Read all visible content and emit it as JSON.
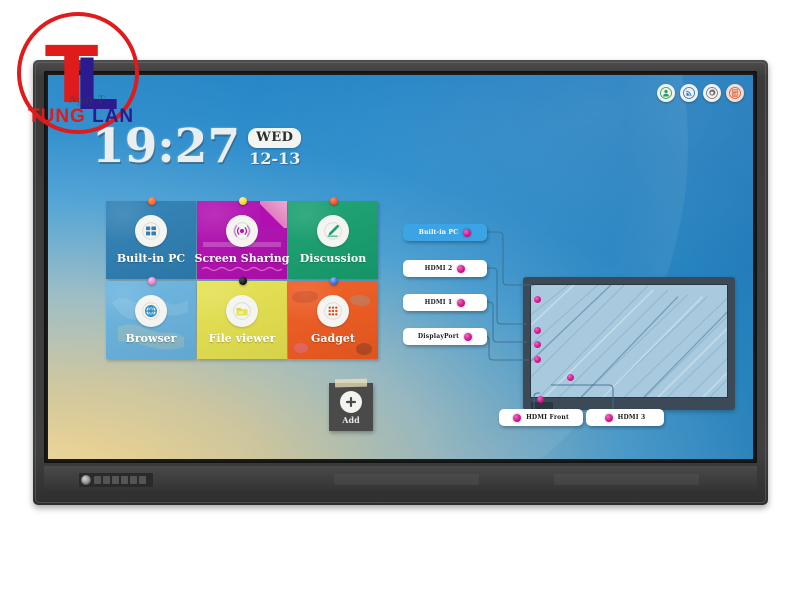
{
  "watermark": {
    "letter_t": "T",
    "letter_l": "L",
    "word_1": "TUNG",
    "word_2": "LAN",
    "subtitle": "Ngày T",
    "ring_color": "#e01b1b",
    "t_color": "#e01b1b",
    "l_color": "#2b1b8f"
  },
  "screen": {
    "clock": {
      "time": "19:27",
      "weekday": "WED",
      "date": "12-13"
    },
    "status_icons": [
      {
        "name": "user-icon",
        "glyph": "user",
        "bg": "#eef3ee",
        "fg": "#2e9a5e"
      },
      {
        "name": "wifi-icon",
        "glyph": "wifi",
        "bg": "#eef1f6",
        "fg": "#2f6fb0"
      },
      {
        "name": "settings-icon",
        "glyph": "gear",
        "bg": "#f1f1f1",
        "fg": "#6c6c6c"
      },
      {
        "name": "menu-icon",
        "glyph": "glyph-cn",
        "bg": "#f3ddd2",
        "fg": "#d8532a"
      }
    ],
    "tiles": [
      {
        "label": "Built-in PC",
        "icon": "windows-icon",
        "color": "#2e7fb4",
        "pin": "#f26a33"
      },
      {
        "label": "Screen Sharing",
        "icon": "broadcast-icon",
        "color": "#b20fb2",
        "pin": "#f2d23a"
      },
      {
        "label": "Discussion",
        "icon": "pencil-icon",
        "color": "#17a06f",
        "pin": "#f0522a"
      },
      {
        "label": "Browser",
        "icon": "globe-icon",
        "color": "#69b4e0",
        "pin": "#e77fc6"
      },
      {
        "label": "File viewer",
        "icon": "folder-icon",
        "color": "#e6e24f",
        "pin": "#1a1a1a"
      },
      {
        "label": "Gadget",
        "icon": "grid-dots-icon",
        "color": "#f05a20",
        "pin": "#3a6fd8"
      }
    ],
    "add_button": {
      "label": "Add",
      "icon": "plus-icon"
    },
    "sources": {
      "left_buttons": [
        {
          "label": "Built-in PC",
          "active": true
        },
        {
          "label": "HDMI 2",
          "active": false
        },
        {
          "label": "HDMI 1",
          "active": false
        },
        {
          "label": "DisplayPort",
          "active": false
        }
      ],
      "bottom_buttons": [
        {
          "label": "HDMI Front",
          "active": false
        },
        {
          "label": "HDMI 3",
          "active": false
        }
      ],
      "dot_color": "#d4168f"
    }
  },
  "hardware": {
    "power_button": "power-button",
    "bezel_color": "#3f3f3f"
  }
}
